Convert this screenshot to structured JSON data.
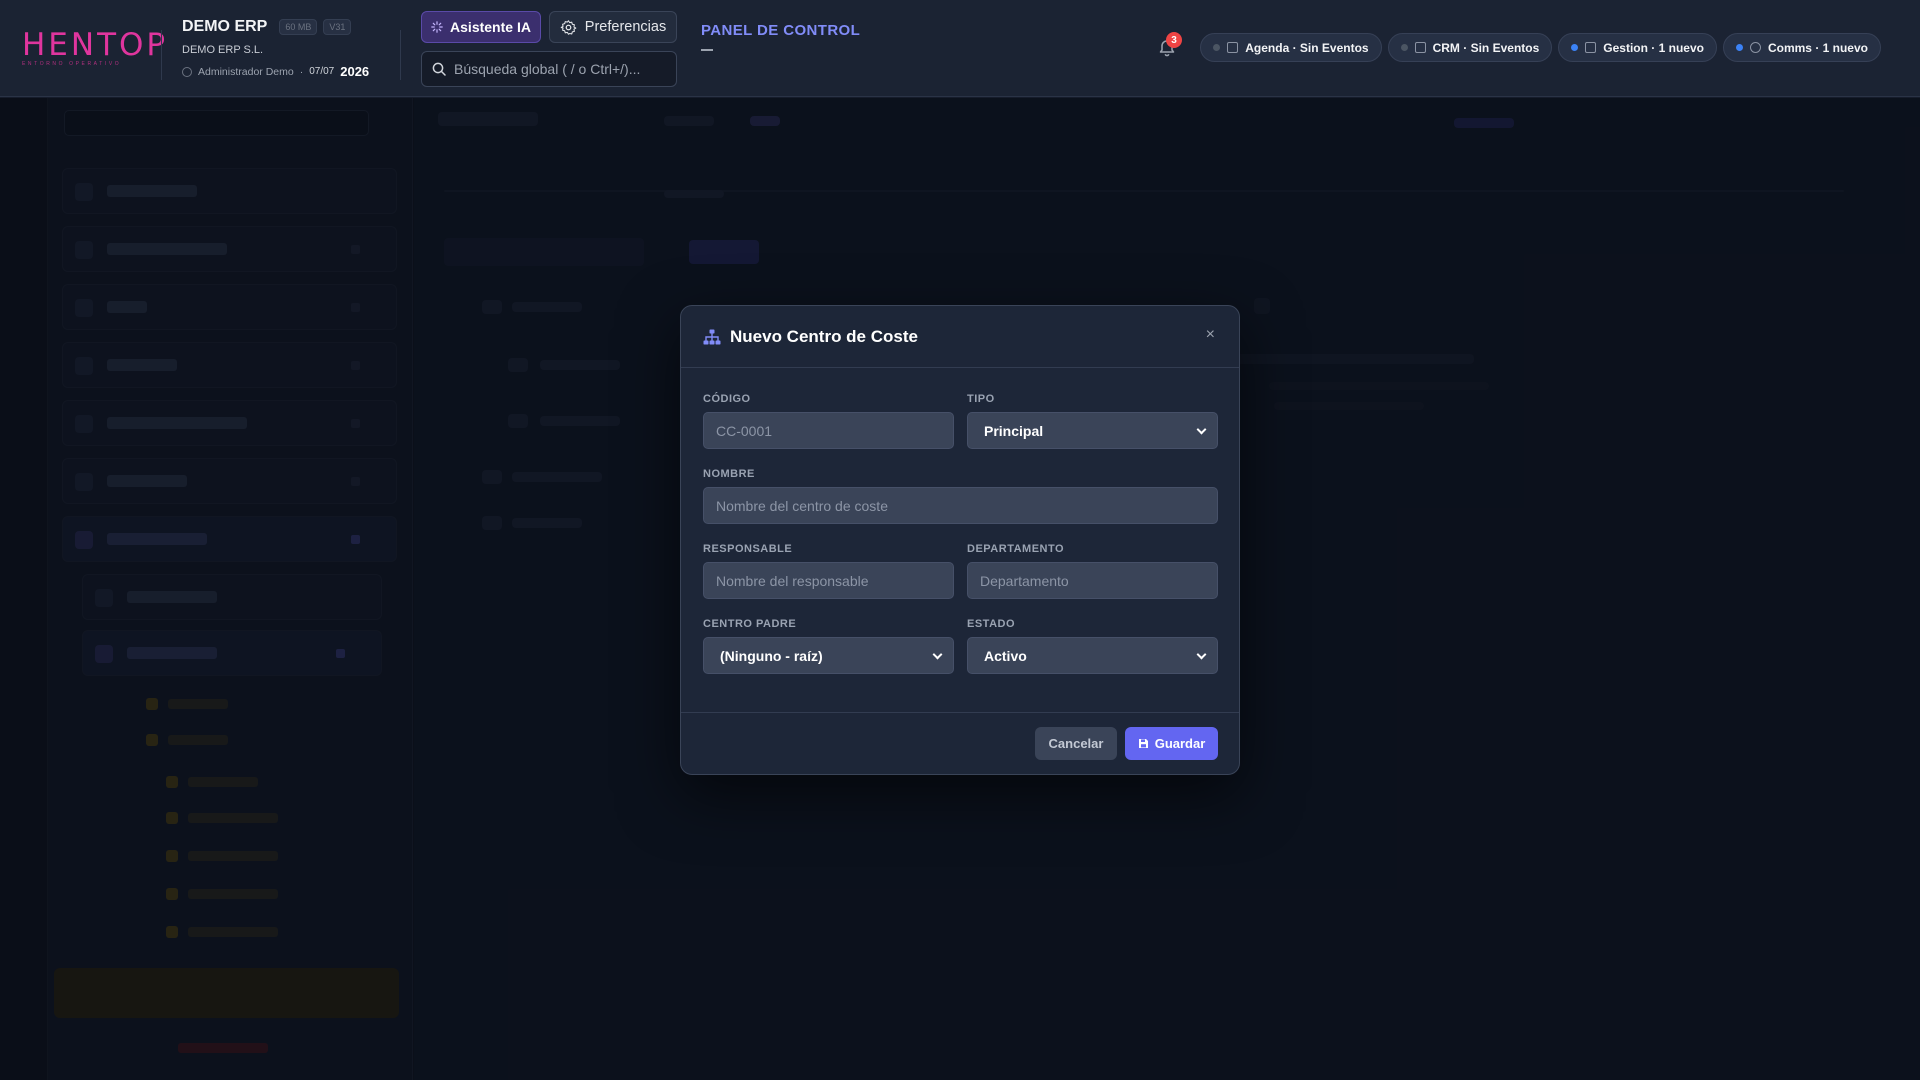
{
  "header": {
    "logo_text": "HENTOP",
    "logo_subtitle": "ENTORNO OPERATIVO",
    "company_name": "DEMO ERP",
    "chip_size": "60 MB",
    "chip_version": "V31",
    "company_legal": "DEMO ERP S.L.",
    "user_name": "Administrador Demo",
    "separator": "·",
    "date": "07/07",
    "year": "2026",
    "ai_button": "Asistente IA",
    "prefs_button": "Preferencias",
    "search_placeholder": "Búsqueda global ( / o Ctrl+/)...",
    "panel_title": "PANEL DE CONTROL",
    "notifications_count": "3",
    "pills": [
      {
        "label": "Agenda · Sin Eventos",
        "dot_color": "#4b5563",
        "icon": "calendar-icon"
      },
      {
        "label": "CRM · Sin Eventos",
        "dot_color": "#4b5563",
        "icon": "chat-icon"
      },
      {
        "label": "Gestion · 1 nuevo",
        "dot_color": "#3b82f6",
        "icon": "document-icon"
      },
      {
        "label": "Comms · 1 nuevo",
        "dot_color": "#3b82f6",
        "icon": "message-icon"
      }
    ]
  },
  "modal": {
    "title": "Nuevo Centro de Coste",
    "close_label": "×",
    "fields": {
      "codigo_label": "CÓDIGO",
      "codigo_placeholder": "CC-0001",
      "tipo_label": "TIPO",
      "tipo_value": "Principal",
      "nombre_label": "NOMBRE",
      "nombre_placeholder": "Nombre del centro de coste",
      "responsable_label": "RESPONSABLE",
      "responsable_placeholder": "Nombre del responsable",
      "departamento_label": "DEPARTAMENTO",
      "departamento_placeholder": "Departamento",
      "padre_label": "CENTRO PADRE",
      "padre_value": "(Ninguno - raíz)",
      "estado_label": "ESTADO",
      "estado_value": "Activo"
    },
    "cancel_label": "Cancelar",
    "save_label": "Guardar"
  },
  "colors": {
    "accent": "#6366f1",
    "brand": "#e0359e",
    "panel_title": "#818cf8",
    "badge": "#ef4444"
  }
}
